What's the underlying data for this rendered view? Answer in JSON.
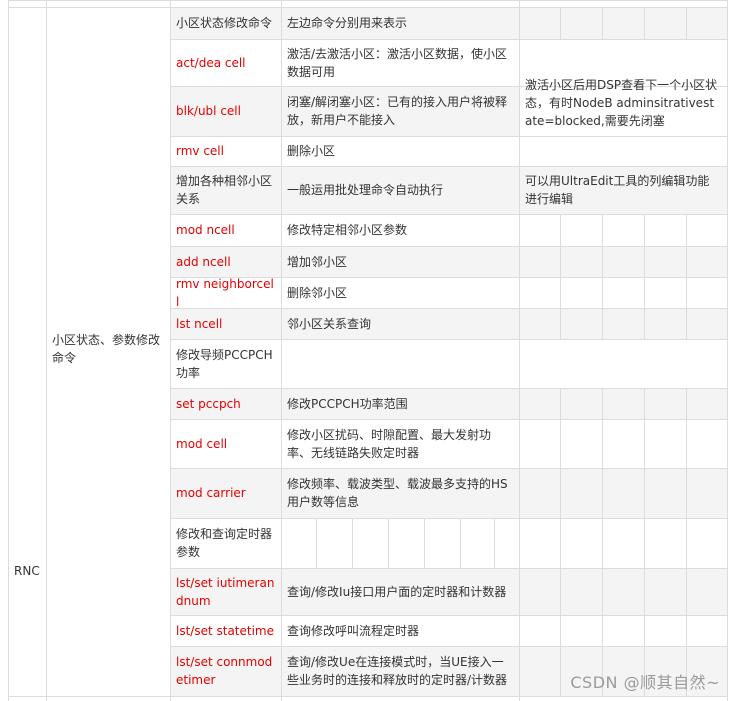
{
  "rnc_label": "RNC",
  "category_label": "小区状态、参数修改命令",
  "rows": [
    {
      "cmd": "小区状态修改命令",
      "desc": "左边命令分别用来表示",
      "cmd_red": false
    },
    {
      "cmd": "act/dea cell",
      "desc": "激活/去激活小区：激活小区数据，使小区数据可用",
      "cmd_red": true
    },
    {
      "cmd": "blk/ubl cell",
      "desc": "闭塞/解闭塞小区：已有的接入用户将被释放，新用户不能接入",
      "cmd_red": true
    },
    {
      "cmd": "rmv cell",
      "desc": "删除小区",
      "cmd_red": true
    },
    {
      "cmd": "增加各种相邻小区关系",
      "desc": "一般运用批处理命令自动执行",
      "cmd_red": false
    },
    {
      "cmd": "mod ncell",
      "desc": "修改特定相邻小区参数",
      "cmd_red": true
    },
    {
      "cmd": "add ncell",
      "desc": "增加邻小区",
      "cmd_red": true
    },
    {
      "cmd": "rmv neighborcell",
      "desc": "删除邻小区",
      "cmd_red": true
    },
    {
      "cmd": "lst ncell",
      "desc": "邻小区关系查询",
      "cmd_red": true
    },
    {
      "cmd": "修改导频PCCPCH功率",
      "desc": "",
      "cmd_red": false
    },
    {
      "cmd": "set pccpch",
      "desc": "修改PCCPCH功率范围",
      "cmd_red": true
    },
    {
      "cmd": "mod cell",
      "desc": "修改小区扰码、时隙配置、最大发射功率、无线链路失败定时器",
      "cmd_red": true
    },
    {
      "cmd": "mod carrier",
      "desc": "修改频率、载波类型、载波最多支持的HS用户数等信息",
      "cmd_red": true
    },
    {
      "cmd": "修改和查询定时器参数",
      "desc": "",
      "cmd_red": false
    },
    {
      "cmd": "lst/set iutimerandnum",
      "desc": "查询/修改Iu接口用户面的定时器和计数器",
      "cmd_red": true
    },
    {
      "cmd": "lst/set statetime",
      "desc": "查询修改呼叫流程定时器",
      "cmd_red": true
    },
    {
      "cmd": "lst/set connmodetimer",
      "desc": "查询/修改Ue在连接模式时，当UE接入一些业务时的连接和释放时的定时器/计数器",
      "cmd_red": true
    }
  ],
  "notes": {
    "activation_note": "激活小区后用DSP查看下一个小区状态，有时NodeB adminsitrativestate=blocked,需要先闭塞",
    "ultraedit_note": "可以用UltraEdit工具的列编辑功能进行编辑"
  },
  "watermark": "CSDN @顺其自然~"
}
